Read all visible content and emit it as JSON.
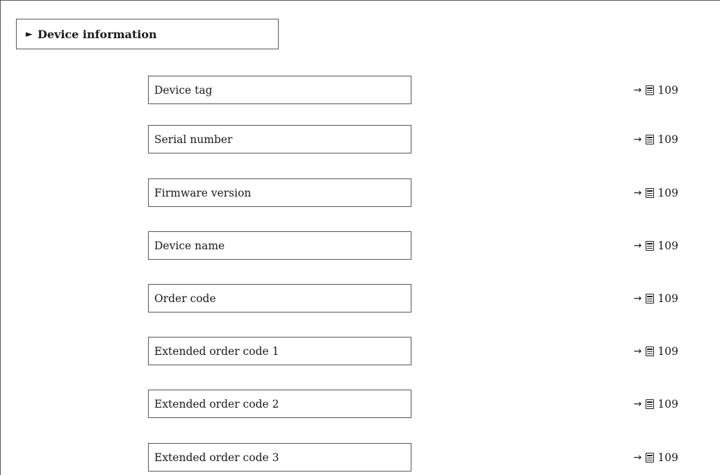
{
  "menu": {
    "marker": "►",
    "title": "Device information"
  },
  "parameters": [
    {
      "label": "Device tag",
      "arrow": "→",
      "page_icon": "document-page-icon",
      "page": "109"
    },
    {
      "label": "Serial number",
      "arrow": "→",
      "page_icon": "document-page-icon",
      "page": "109"
    },
    {
      "label": "Firmware version",
      "arrow": "→",
      "page_icon": "document-page-icon",
      "page": "109"
    },
    {
      "label": "Device name",
      "arrow": "→",
      "page_icon": "document-page-icon",
      "page": "109"
    },
    {
      "label": "Order code",
      "arrow": "→",
      "page_icon": "document-page-icon",
      "page": "109"
    },
    {
      "label": "Extended order code 1",
      "arrow": "→",
      "page_icon": "document-page-icon",
      "page": "109"
    },
    {
      "label": "Extended order code 2",
      "arrow": "→",
      "page_icon": "document-page-icon",
      "page": "109"
    },
    {
      "label": "Extended order code 3",
      "arrow": "→",
      "page_icon": "document-page-icon",
      "page": "109"
    }
  ]
}
